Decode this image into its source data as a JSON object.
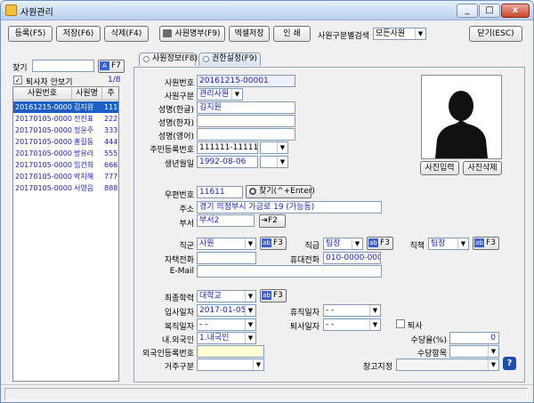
{
  "window": {
    "title": "사원관리",
    "min": "_",
    "max": "□",
    "close": "x"
  },
  "toolbar": {
    "register": "등록(F5)",
    "save": "저장(F6)",
    "delete": "삭제(F4)",
    "print_list": "사원명부(F9)",
    "excel_save": "엑셀저장",
    "print": "인 쇄",
    "filter_label": "사원구분별검색",
    "filter_value": "모든사원",
    "close": "닫기(ESC)"
  },
  "left": {
    "find_label": "찾기",
    "find_value": "",
    "find_button": "F7",
    "retired_check_label": "퇴사자 안보기",
    "retired_checked": true,
    "counter": "1/8",
    "columns": [
      "사원번호",
      "사원명",
      "주"
    ],
    "rows": [
      {
        "id": "20161215-00001",
        "name": "김지원",
        "rrn": "111"
      },
      {
        "id": "20170105-00001",
        "name": "전진표",
        "rrn": "222"
      },
      {
        "id": "20170105-00002",
        "name": "정윤주",
        "rrn": "333"
      },
      {
        "id": "20170105-00003",
        "name": "홍길동",
        "rrn": "444"
      },
      {
        "id": "20170105-00004",
        "name": "방유라",
        "rrn": "555"
      },
      {
        "id": "20170105-00005",
        "name": "임건희",
        "rrn": "666"
      },
      {
        "id": "20170105-00006",
        "name": "박지혜",
        "rrn": "777"
      },
      {
        "id": "20170105-00007",
        "name": "서영음",
        "rrn": "888"
      }
    ]
  },
  "tabs": [
    "사원정보(F8)",
    "권한설정(F9)"
  ],
  "form": {
    "emp_no_label": "사원번호",
    "emp_no": "20161215-00001",
    "emp_type_label": "사원구분",
    "emp_type": "관리사원",
    "name_kr_label": "성명(한글)",
    "name_kr": "김지원",
    "name_hanja_label": "성명(한자)",
    "name_hanja": "",
    "name_en_label": "성명(영어)",
    "name_en": "",
    "rrn_label": "주민등록번호",
    "rrn": "111111-1111111",
    "birth_label": "생년월일",
    "birth": "1992-08-06",
    "zip_label": "우편번호",
    "zip": "11611",
    "zip_search": "찾기(^+Enter)",
    "addr_label": "주소",
    "addr": "경기 의정부시 가금로 19 (가능동)",
    "dept_label": "부서",
    "dept": "부서2",
    "dept_btn": "F2",
    "rank_label": "직군",
    "rank": "사원",
    "f3": "F3",
    "grade_label": "직급",
    "grade": "팀장",
    "duty_label": "직책",
    "duty": "팀장",
    "home_phone_label": "자택전화",
    "home_phone": "",
    "mobile_label": "휴대전화",
    "mobile": "010-0000-0000",
    "email_label": "E-Mail",
    "email": "",
    "edu_label": "최종학력",
    "edu": "대학교",
    "join_label": "입사일자",
    "join": "2017-01-05",
    "leave_label": "휴직일자",
    "leave": " -  - ",
    "return_label": "복직일자",
    "return": " -  - ",
    "retire_label": "퇴사일자",
    "retire": " -  - ",
    "retire_chk": "퇴사",
    "nat_label": "내.외국인",
    "nat": "1.내국인",
    "allow_rate_label": "수당율(%)",
    "allow_rate": "0",
    "foreign_no_label": "외국인등록번호",
    "foreign_no": "",
    "allow_item_label": "수당항목",
    "allow_item": "",
    "resid_label": "거주구분",
    "resid": "",
    "warehouse_label": "창고지정",
    "warehouse": "",
    "help": "?"
  },
  "photo": {
    "upload": "사진입력",
    "delete": "사진삭제"
  }
}
